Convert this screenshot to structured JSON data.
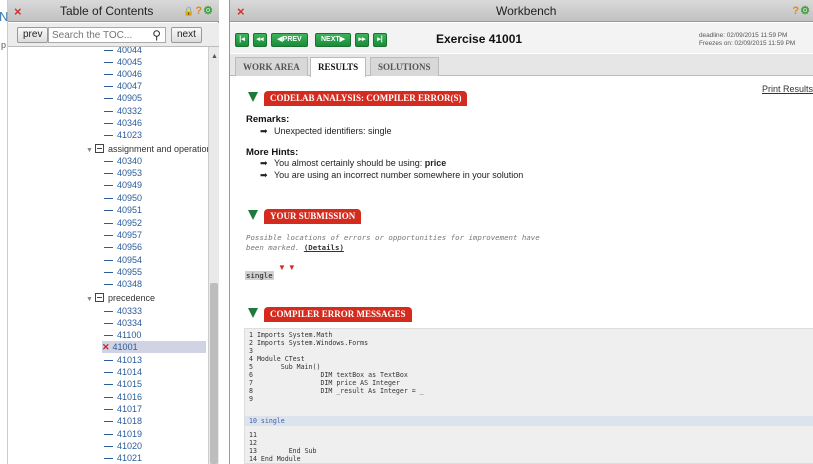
{
  "edge": {
    "letter_n": "N",
    "letter_p": "p"
  },
  "toc": {
    "title": "Table of Contents",
    "close_glyph": "×",
    "header_icons": [
      "lock-icon",
      "help-icon",
      "settings-icon"
    ],
    "header_glyphs": {
      "lock": "🔒",
      "help": "?",
      "settings": "⚙"
    },
    "prev_label": "prev",
    "next_label": "next",
    "search_placeholder": "Search the TOC...",
    "search_glyph": "🔍",
    "items_top": [
      "40044",
      "40045",
      "40046",
      "40047",
      "40905",
      "40332",
      "40346",
      "41023"
    ],
    "group1": "assignment and operations",
    "items_group1": [
      "40340",
      "40953",
      "40949",
      "40950",
      "40951",
      "40952",
      "40957",
      "40956",
      "40954",
      "40955",
      "40348"
    ],
    "group2": "precedence",
    "items_group2": [
      "40333",
      "40334",
      "41100",
      "41001",
      "41013",
      "41014",
      "41015",
      "41016",
      "41017",
      "41018",
      "41019",
      "41020",
      "41021"
    ],
    "current_item": "41001",
    "current_mark": "✕"
  },
  "workbench": {
    "title": "Workbench",
    "close_glyph": "×",
    "header_glyphs": {
      "help": "?",
      "settings": "⚙"
    },
    "nav_buttons": {
      "first": "|◂",
      "back": "◂◂",
      "prev": "◀PREV",
      "next": "NEXT▶",
      "forward": "▸▸",
      "last": "▸|"
    },
    "exercise_title": "Exercise 41001",
    "deadline": "deadline: 02/09/2015 11:59 PM",
    "freezes": "Freezes on: 02/09/2015 11:59 PM",
    "tabs": [
      "WORK AREA",
      "RESULTS",
      "SOLUTIONS"
    ],
    "active_tab": "RESULTS",
    "print_results": "Print Results",
    "analysis": {
      "title": "CODELAB ANALYSIS: COMPILER ERROR(S)",
      "remarks_label": "Remarks:",
      "bullet_glyph": "➡",
      "remark": "Unexpected identifiers: single",
      "hints_label": "More Hints:",
      "hint1_prefix": "You almost certainly should be using:",
      "hint1_value": "price",
      "hint2": "You are using an incorrect number somewhere in your solution"
    },
    "submission": {
      "title": "YOUR SUBMISSION",
      "note_line1": "Possible locations of errors or opportunities for improvement have",
      "note_line2_prefix": "been marked.",
      "details_link": "(Details)",
      "markers": "▼▼",
      "code": "single"
    },
    "compiler": {
      "title": "COMPILER ERROR MESSAGES",
      "lines": [
        "1 Imports System.Math",
        "2 Imports System.Windows.Forms",
        "3",
        "4 Module CTest",
        "5       Sub Main()",
        "6                 DIM textBox as TextBox",
        "7                 DIM price AS Integer",
        "8                 DIM _result As Integer = _",
        "9",
        "10 single",
        "11",
        "12",
        "13        End Sub",
        "14 End Module"
      ]
    }
  }
}
